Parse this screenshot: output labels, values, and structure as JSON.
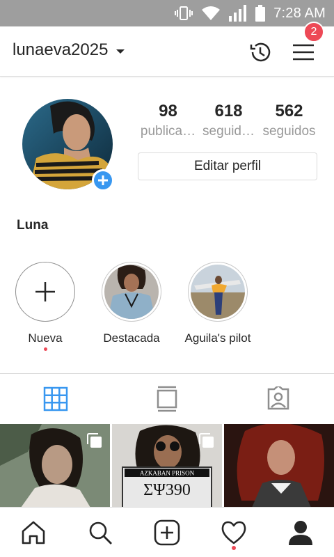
{
  "status_bar": {
    "time": "7:28 AM",
    "icons": [
      "vibrate-icon",
      "wifi-icon",
      "signal-icon",
      "battery-icon"
    ]
  },
  "header": {
    "username": "lunaeva2025",
    "notification_count": "2",
    "icons": [
      "history-icon",
      "menu-icon"
    ]
  },
  "profile": {
    "full_name": "Luna",
    "stats": [
      {
        "value": "98",
        "label": "publica…"
      },
      {
        "value": "618",
        "label": "seguid…"
      },
      {
        "value": "562",
        "label": "seguidos"
      }
    ],
    "edit_button_label": "Editar perfil"
  },
  "highlights": [
    {
      "label": "Nueva",
      "type": "new"
    },
    {
      "label": "Destacada",
      "type": "photo"
    },
    {
      "label": "Aguila's pilot",
      "type": "photo"
    }
  ],
  "tabs": [
    {
      "name": "grid",
      "icon": "grid-icon",
      "active": true
    },
    {
      "name": "feed",
      "icon": "feed-list-icon",
      "active": false
    },
    {
      "name": "tagged",
      "icon": "tagged-person-icon",
      "active": false
    }
  ],
  "grid_posts": [
    {
      "id": "post-1",
      "multi": true
    },
    {
      "id": "post-2",
      "multi": true,
      "sign_text_top": "AZKABAN PRISON",
      "sign_text_main": "ΣΨ390"
    },
    {
      "id": "post-3",
      "multi": false
    }
  ],
  "bottom_nav": [
    {
      "icon": "home-icon"
    },
    {
      "icon": "search-icon"
    },
    {
      "icon": "new-post-icon"
    },
    {
      "icon": "heart-icon",
      "has_dot": true
    },
    {
      "icon": "profile-icon",
      "active": true
    }
  ],
  "colors": {
    "accent_blue": "#3897f0",
    "badge_red": "#ed4956",
    "status_bar": "#9e9e9e",
    "text": "#262626",
    "muted": "#999999"
  }
}
